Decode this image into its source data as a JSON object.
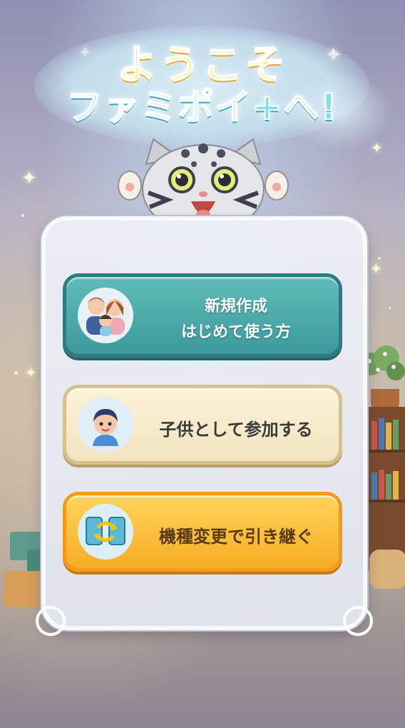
{
  "title": {
    "line1": "ようこそ",
    "line2": "ファミポイ+へ!"
  },
  "buttons": {
    "new_line1": "新規作成",
    "new_line2": "はじめて使う方",
    "join_child": "子供として参加する",
    "transfer": "機種変更で引き継ぐ"
  },
  "icons": {
    "new": "family-icon",
    "join_child": "child-avatar-icon",
    "transfer": "device-transfer-icon"
  }
}
